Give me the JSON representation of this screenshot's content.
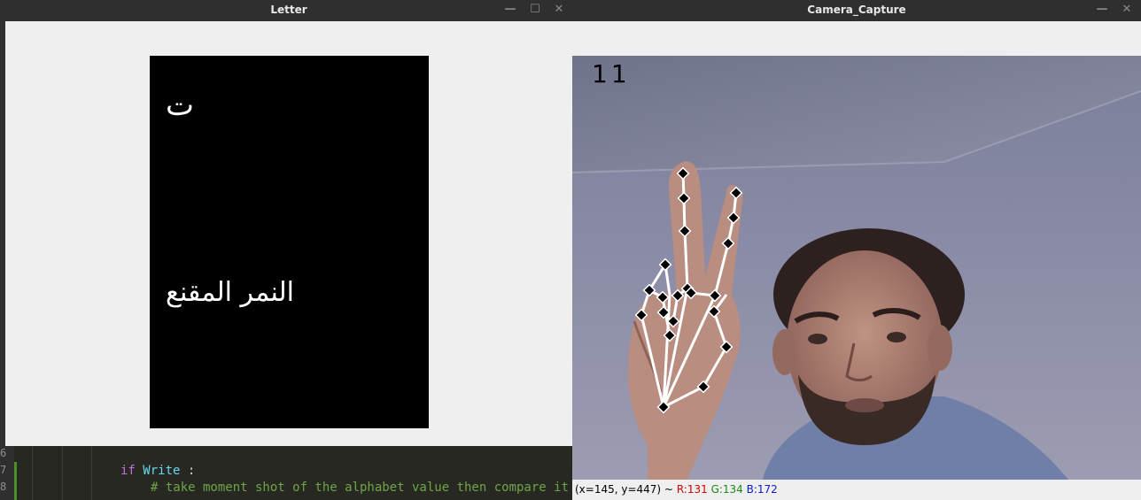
{
  "editor": {
    "line_numbers": [
      "6",
      "7",
      "8"
    ],
    "line_if_keyword": "if",
    "line_if_var": "Write",
    "line_if_colon": " :",
    "line_comment": "# take moment shot of the alphabet value then compare it"
  },
  "letter_window": {
    "title": "Letter",
    "letter": "ت",
    "animal_name": "النمر المقنع"
  },
  "camera_window": {
    "title": "Camera_Capture",
    "counter": "11",
    "status": {
      "coords": "(x=145, y=447) ~",
      "r": "R:131",
      "g": "G:134",
      "b": "B:172"
    }
  },
  "window_controls": {
    "minimize": "—",
    "maximize": "☐",
    "close": "✕"
  },
  "colors": {
    "titlebar": "#2f2f2f",
    "window_bg": "#efefef",
    "letter_panel": "#000000",
    "hand_skeleton": "#ffffff",
    "landmark": "#000000"
  }
}
